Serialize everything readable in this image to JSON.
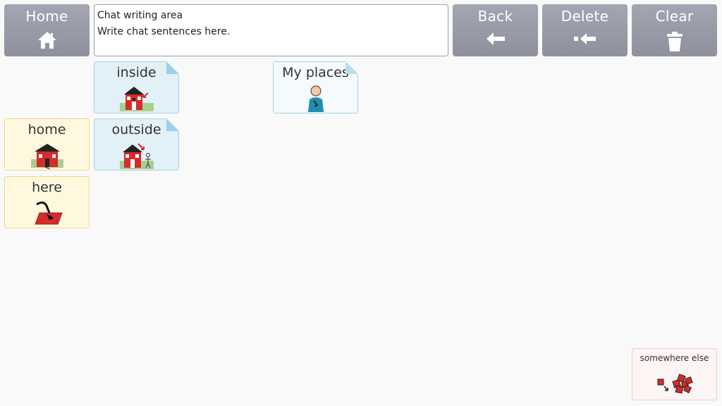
{
  "toolbar": {
    "home_label": "Home",
    "back_label": "Back",
    "delete_label": "Delete",
    "clear_label": "Clear",
    "icons": {
      "home": "home-icon",
      "back": "arrow-left-icon",
      "delete": "backspace-icon",
      "clear": "trash-icon"
    }
  },
  "chat": {
    "title": "Chat writing area",
    "placeholder": "Write chat sentences here."
  },
  "tiles": {
    "inside": {
      "label": "inside",
      "icon": "house-inside-icon"
    },
    "my_places": {
      "label": "My places",
      "icon": "person-icon"
    },
    "home": {
      "label": "home",
      "icon": "house-icon"
    },
    "outside": {
      "label": "outside",
      "icon": "house-outside-icon"
    },
    "here": {
      "label": "here",
      "icon": "pointing-down-icon"
    },
    "somewhere_else": {
      "label": "somewhere else",
      "icon": "scattered-squares-icon"
    }
  },
  "colors": {
    "toolbar": "#9a9da8",
    "folder_tile": "#e2f0f7",
    "word_tile": "#fef8df",
    "house_red": "#d42b2b"
  }
}
